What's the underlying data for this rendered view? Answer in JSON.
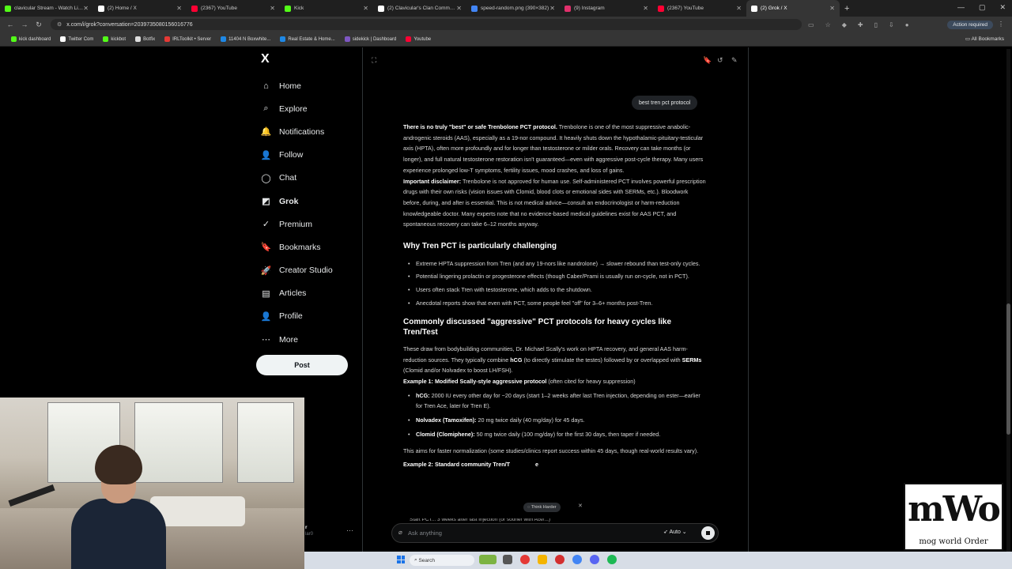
{
  "browser": {
    "tabs": [
      {
        "label": "clavicular Stream - Watch Live o...",
        "favicon_color": "#53fc18"
      },
      {
        "label": "(2) Home / X",
        "favicon_color": "#ffffff"
      },
      {
        "label": "(2367) YouTube",
        "favicon_color": "#ff0033"
      },
      {
        "label": "Kick",
        "favicon_color": "#53fc18"
      },
      {
        "label": "(2) Clavicular's Clan Communit...",
        "favicon_color": "#ffffff"
      },
      {
        "label": "speed-random.png (390×382)",
        "favicon_color": "#4285f4"
      },
      {
        "label": "(9) Instagram",
        "favicon_color": "#e1306c"
      },
      {
        "label": "(2367) YouTube",
        "favicon_color": "#ff0033"
      },
      {
        "label": "(2) Grok / X",
        "favicon_color": "#ffffff"
      }
    ],
    "active_tab_index": 8,
    "url": "x.com/i/grok?conversation=2039735080156016776",
    "action_required": "Action required",
    "bookmarks": [
      {
        "label": "kick dashboard",
        "color": "#53fc18"
      },
      {
        "label": "Twitter Com",
        "color": "#ffffff"
      },
      {
        "label": "kickbot",
        "color": "#53fc18"
      },
      {
        "label": "Botfix",
        "color": "#dddddd"
      },
      {
        "label": "IRLToolkit • Server",
        "color": "#e53935"
      },
      {
        "label": "11404 N Boxwhite...",
        "color": "#1e88e5"
      },
      {
        "label": "Real Estate & Home...",
        "color": "#1e88e5"
      },
      {
        "label": "sidekick | Dashboard",
        "color": "#7e57c2"
      },
      {
        "label": "Youtube",
        "color": "#ff0033"
      }
    ],
    "all_bookmarks": "All Bookmarks"
  },
  "sidebar": {
    "logo": "X",
    "items": [
      {
        "label": "Home",
        "icon": "home-icon",
        "glyph": "⌂"
      },
      {
        "label": "Explore",
        "icon": "search-icon",
        "glyph": "⌕"
      },
      {
        "label": "Notifications",
        "icon": "bell-icon",
        "glyph": "🔔"
      },
      {
        "label": "Follow",
        "icon": "person-plus-icon",
        "glyph": "👤"
      },
      {
        "label": "Chat",
        "icon": "chat-icon",
        "glyph": "◯"
      },
      {
        "label": "Grok",
        "icon": "grok-icon",
        "glyph": "◩"
      },
      {
        "label": "Premium",
        "icon": "premium-icon",
        "glyph": "✓"
      },
      {
        "label": "Bookmarks",
        "icon": "bookmark-icon",
        "glyph": "🔖"
      },
      {
        "label": "Creator Studio",
        "icon": "rocket-icon",
        "glyph": "🚀"
      },
      {
        "label": "Articles",
        "icon": "article-icon",
        "glyph": "▤"
      },
      {
        "label": "Profile",
        "icon": "profile-icon",
        "glyph": "👤"
      },
      {
        "label": "More",
        "icon": "more-icon",
        "glyph": "⋯"
      }
    ],
    "active": "Grok",
    "post_label": "Post",
    "account": {
      "name": "r",
      "handle": "lar0"
    }
  },
  "chat": {
    "user_message": "best tren pct protocol",
    "p1_bold": "There is no truly \"best\" or safe Trenbolone PCT protocol.",
    "p1_text": " Trenbolone is one of the most suppressive anabolic-androgenic steroids (AAS), especially as a 19-nor compound. It heavily shuts down the hypothalamic-pituitary-testicular axis (HPTA), often more profoundly and for longer than testosterone or milder orals. Recovery can take months (or longer), and full natural testosterone restoration isn't guaranteed—even with aggressive post-cycle therapy. Many users experience prolonged low-T symptoms, fertility issues, mood crashes, and loss of gains.",
    "p2_bold": "Important disclaimer:",
    "p2_text": " Trenbolone is not approved for human use. Self-administered PCT involves powerful prescription drugs with their own risks (vision issues with Clomid, blood clots or emotional sides with SERMs, etc.). Bloodwork before, during, and after is essential. This is not medical advice—consult an endocrinologist or harm-reduction knowledgeable doctor. Many experts note that no evidence-based medical guidelines exist for AAS PCT, and spontaneous recovery can take 6–12 months anyway.",
    "h_why": "Why Tren PCT is particularly challenging",
    "why_items": [
      "Extreme HPTA suppression from Tren (and any 19-nors like nandrolone) → slower rebound than test-only cycles.",
      "Potential lingering prolactin or progesterone effects (though Caber/Prami is usually run on-cycle, not in PCT).",
      "Users often stack Tren with testosterone, which adds to the shutdown.",
      "Anecdotal reports show that even with PCT, some people feel \"off\" for 3–6+ months post-Tren."
    ],
    "h_common": "Commonly discussed \"aggressive\" PCT protocols for heavy cycles like Tren/Test",
    "p3_a": "These draw from bodybuilding communities, Dr. Michael Scally's work on HPTA recovery, and general AAS harm-reduction sources. They typically combine ",
    "p3_b1": "hCG",
    "p3_c": " (to directly stimulate the testes) followed by or overlapped with ",
    "p3_b2": "SERMs",
    "p3_d": " (Clomid and/or Nolvadex to boost LH/FSH).",
    "ex1_bold": "Example 1: Modified Scally-style aggressive protocol",
    "ex1_text": " (often cited for heavy suppression)",
    "ex1_items": [
      {
        "bold": "hCG:",
        "text": " 2000 IU every other day for ~20 days (start 1–2 weeks after last Tren injection, depending on ester—earlier for Tren Ace, later for Tren E)."
      },
      {
        "bold": "Nolvadex (Tamoxifen):",
        "text": " 20 mg twice daily (40 mg/day) for 45 days."
      },
      {
        "bold": "Clomid (Clomiphene):",
        "text": " 50 mg twice daily (100 mg/day) for the first 30 days, then taper if needed."
      }
    ],
    "p4": "This aims for faster normalization (some studies/clinics report success within 45 days, though real-world results vary).",
    "ex2_bold": "Example 2: Standard community Tren/T",
    "ex2_tail": "e",
    "obscured_line": "Start PCT... 3 weeks after last injection (or sooner with Ace/...)",
    "think_chip": "Think Harder",
    "input_placeholder": "Ask anything",
    "mode": "Auto"
  },
  "overlay": {
    "logo_text": "mWo",
    "logo_sub": "mog world Order"
  },
  "taskbar": {
    "search_placeholder": "Search"
  }
}
